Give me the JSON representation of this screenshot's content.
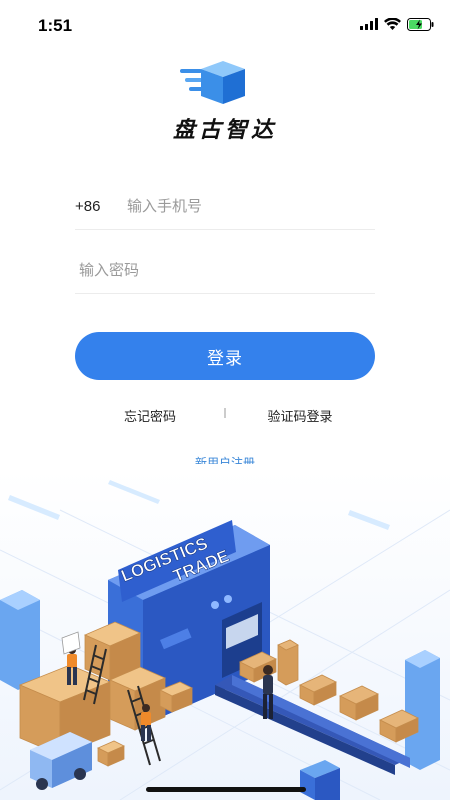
{
  "status_bar": {
    "time": "1:51",
    "icons": [
      "cellular-signal-icon",
      "wifi-icon",
      "battery-charging-icon"
    ]
  },
  "brand": {
    "logo_icon": "box-delivery-icon",
    "name": "盘古智达"
  },
  "form": {
    "country_code": "+86",
    "phone_placeholder": "输入手机号",
    "phone_value": "",
    "password_placeholder": "输入密码",
    "password_value": ""
  },
  "actions": {
    "login_label": "登录",
    "forgot_password_label": "忘记密码",
    "sms_login_label": "验证码登录",
    "register_label": "新用户注册"
  },
  "illustration": {
    "sign_line1": "LOGISTICS",
    "sign_line2": "TRADE"
  },
  "colors": {
    "accent": "#3481ec",
    "link": "#3a87d8",
    "logo_blue": "#3b8fe8"
  }
}
